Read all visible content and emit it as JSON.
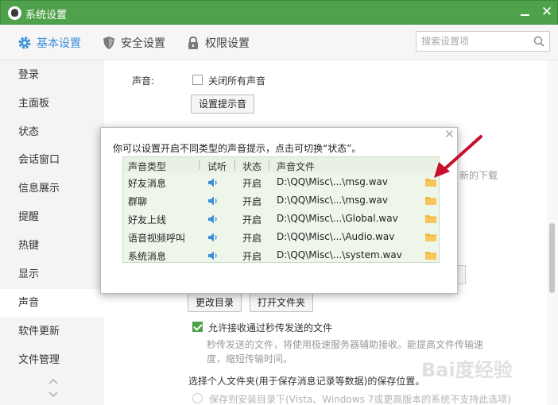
{
  "window": {
    "title": "系统设置"
  },
  "tabs": [
    {
      "label": "基本设置",
      "icon": "gear-icon"
    },
    {
      "label": "安全设置",
      "icon": "shield-icon"
    },
    {
      "label": "权限设置",
      "icon": "lock-icon"
    }
  ],
  "search": {
    "placeholder": "搜索设置项"
  },
  "sidebar": {
    "items": [
      "登录",
      "主面板",
      "状态",
      "会话窗口",
      "信息展示",
      "提醒",
      "热键",
      "显示",
      "声音",
      "软件更新",
      "文件管理"
    ],
    "active": "声音"
  },
  "sound": {
    "label": "声音:",
    "mute_all_label": "关闭所有声音",
    "mute_all_checked": false,
    "config_button": "设置提示音"
  },
  "background": {
    "partial_text": "新的下载",
    "change_dir_button": "更改目录",
    "open_folder_button": "打开文件夹",
    "allow_transfer_label": "允许接收通过秒传发送的文件",
    "allow_transfer_checked": true,
    "transfer_desc_1": "秒传发送的文件，将使用极速服务器辅助接收。能提高文件传输速",
    "transfer_desc_2": "度，缩短传输时间。",
    "personal_folder_title": "选择个人文件夹(用于保存消息记录等数据)的保存位置。",
    "save_install_dir_option": "保存到安装目录下(Vista、Windows 7或更高版本的系统不支持此选项)"
  },
  "popup": {
    "message": "你可以设置开启不同类型的声音提示，点击可切换“状态”。",
    "headers": [
      "声音类型",
      "试听",
      "状态",
      "声音文件"
    ],
    "rows": [
      {
        "type": "好友消息",
        "status": "开启",
        "file": "D:\\QQ\\Misc\\...\\msg.wav"
      },
      {
        "type": "群聊",
        "status": "开启",
        "file": "D:\\QQ\\Misc\\...\\msg.wav"
      },
      {
        "type": "好友上线",
        "status": "开启",
        "file": "D:\\QQ\\Misc\\...\\Global.wav"
      },
      {
        "type": "语音视频呼叫",
        "status": "开启",
        "file": "D:\\QQ\\Misc\\...\\Audio.wav"
      },
      {
        "type": "系统消息",
        "status": "开启",
        "file": "D:\\QQ\\Misc\\...\\system.wav"
      }
    ]
  },
  "watermark": {
    "text": "Bai度经验"
  },
  "colors": {
    "titlebar": "#4fa14b",
    "accent": "#3a8fd8",
    "arrow": "#c8102e",
    "folder": "#f5b63e"
  }
}
